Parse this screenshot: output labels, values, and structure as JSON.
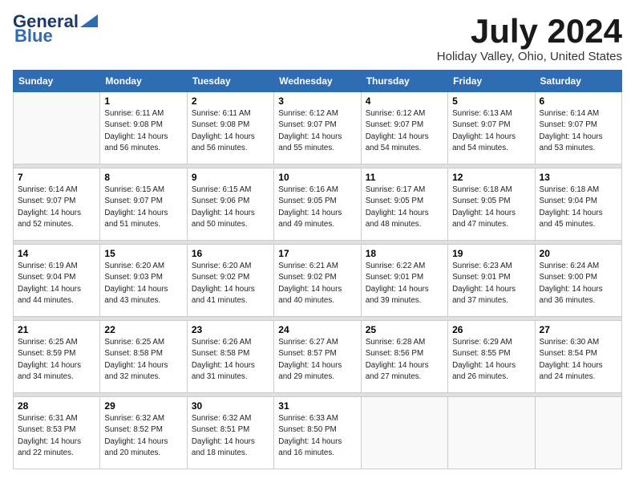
{
  "header": {
    "logo_general": "General",
    "logo_blue": "Blue",
    "month": "July 2024",
    "location": "Holiday Valley, Ohio, United States"
  },
  "days_of_week": [
    "Sunday",
    "Monday",
    "Tuesday",
    "Wednesday",
    "Thursday",
    "Friday",
    "Saturday"
  ],
  "weeks": [
    [
      {
        "day": "",
        "sunrise": "",
        "sunset": "",
        "daylight": ""
      },
      {
        "day": "1",
        "sunrise": "Sunrise: 6:11 AM",
        "sunset": "Sunset: 9:08 PM",
        "daylight": "Daylight: 14 hours and 56 minutes."
      },
      {
        "day": "2",
        "sunrise": "Sunrise: 6:11 AM",
        "sunset": "Sunset: 9:08 PM",
        "daylight": "Daylight: 14 hours and 56 minutes."
      },
      {
        "day": "3",
        "sunrise": "Sunrise: 6:12 AM",
        "sunset": "Sunset: 9:07 PM",
        "daylight": "Daylight: 14 hours and 55 minutes."
      },
      {
        "day": "4",
        "sunrise": "Sunrise: 6:12 AM",
        "sunset": "Sunset: 9:07 PM",
        "daylight": "Daylight: 14 hours and 54 minutes."
      },
      {
        "day": "5",
        "sunrise": "Sunrise: 6:13 AM",
        "sunset": "Sunset: 9:07 PM",
        "daylight": "Daylight: 14 hours and 54 minutes."
      },
      {
        "day": "6",
        "sunrise": "Sunrise: 6:14 AM",
        "sunset": "Sunset: 9:07 PM",
        "daylight": "Daylight: 14 hours and 53 minutes."
      }
    ],
    [
      {
        "day": "7",
        "sunrise": "Sunrise: 6:14 AM",
        "sunset": "Sunset: 9:07 PM",
        "daylight": "Daylight: 14 hours and 52 minutes."
      },
      {
        "day": "8",
        "sunrise": "Sunrise: 6:15 AM",
        "sunset": "Sunset: 9:07 PM",
        "daylight": "Daylight: 14 hours and 51 minutes."
      },
      {
        "day": "9",
        "sunrise": "Sunrise: 6:15 AM",
        "sunset": "Sunset: 9:06 PM",
        "daylight": "Daylight: 14 hours and 50 minutes."
      },
      {
        "day": "10",
        "sunrise": "Sunrise: 6:16 AM",
        "sunset": "Sunset: 9:05 PM",
        "daylight": "Daylight: 14 hours and 49 minutes."
      },
      {
        "day": "11",
        "sunrise": "Sunrise: 6:17 AM",
        "sunset": "Sunset: 9:05 PM",
        "daylight": "Daylight: 14 hours and 48 minutes."
      },
      {
        "day": "12",
        "sunrise": "Sunrise: 6:18 AM",
        "sunset": "Sunset: 9:05 PM",
        "daylight": "Daylight: 14 hours and 47 minutes."
      },
      {
        "day": "13",
        "sunrise": "Sunrise: 6:18 AM",
        "sunset": "Sunset: 9:04 PM",
        "daylight": "Daylight: 14 hours and 45 minutes."
      }
    ],
    [
      {
        "day": "14",
        "sunrise": "Sunrise: 6:19 AM",
        "sunset": "Sunset: 9:04 PM",
        "daylight": "Daylight: 14 hours and 44 minutes."
      },
      {
        "day": "15",
        "sunrise": "Sunrise: 6:20 AM",
        "sunset": "Sunset: 9:03 PM",
        "daylight": "Daylight: 14 hours and 43 minutes."
      },
      {
        "day": "16",
        "sunrise": "Sunrise: 6:20 AM",
        "sunset": "Sunset: 9:02 PM",
        "daylight": "Daylight: 14 hours and 41 minutes."
      },
      {
        "day": "17",
        "sunrise": "Sunrise: 6:21 AM",
        "sunset": "Sunset: 9:02 PM",
        "daylight": "Daylight: 14 hours and 40 minutes."
      },
      {
        "day": "18",
        "sunrise": "Sunrise: 6:22 AM",
        "sunset": "Sunset: 9:01 PM",
        "daylight": "Daylight: 14 hours and 39 minutes."
      },
      {
        "day": "19",
        "sunrise": "Sunrise: 6:23 AM",
        "sunset": "Sunset: 9:01 PM",
        "daylight": "Daylight: 14 hours and 37 minutes."
      },
      {
        "day": "20",
        "sunrise": "Sunrise: 6:24 AM",
        "sunset": "Sunset: 9:00 PM",
        "daylight": "Daylight: 14 hours and 36 minutes."
      }
    ],
    [
      {
        "day": "21",
        "sunrise": "Sunrise: 6:25 AM",
        "sunset": "Sunset: 8:59 PM",
        "daylight": "Daylight: 14 hours and 34 minutes."
      },
      {
        "day": "22",
        "sunrise": "Sunrise: 6:25 AM",
        "sunset": "Sunset: 8:58 PM",
        "daylight": "Daylight: 14 hours and 32 minutes."
      },
      {
        "day": "23",
        "sunrise": "Sunrise: 6:26 AM",
        "sunset": "Sunset: 8:58 PM",
        "daylight": "Daylight: 14 hours and 31 minutes."
      },
      {
        "day": "24",
        "sunrise": "Sunrise: 6:27 AM",
        "sunset": "Sunset: 8:57 PM",
        "daylight": "Daylight: 14 hours and 29 minutes."
      },
      {
        "day": "25",
        "sunrise": "Sunrise: 6:28 AM",
        "sunset": "Sunset: 8:56 PM",
        "daylight": "Daylight: 14 hours and 27 minutes."
      },
      {
        "day": "26",
        "sunrise": "Sunrise: 6:29 AM",
        "sunset": "Sunset: 8:55 PM",
        "daylight": "Daylight: 14 hours and 26 minutes."
      },
      {
        "day": "27",
        "sunrise": "Sunrise: 6:30 AM",
        "sunset": "Sunset: 8:54 PM",
        "daylight": "Daylight: 14 hours and 24 minutes."
      }
    ],
    [
      {
        "day": "28",
        "sunrise": "Sunrise: 6:31 AM",
        "sunset": "Sunset: 8:53 PM",
        "daylight": "Daylight: 14 hours and 22 minutes."
      },
      {
        "day": "29",
        "sunrise": "Sunrise: 6:32 AM",
        "sunset": "Sunset: 8:52 PM",
        "daylight": "Daylight: 14 hours and 20 minutes."
      },
      {
        "day": "30",
        "sunrise": "Sunrise: 6:32 AM",
        "sunset": "Sunset: 8:51 PM",
        "daylight": "Daylight: 14 hours and 18 minutes."
      },
      {
        "day": "31",
        "sunrise": "Sunrise: 6:33 AM",
        "sunset": "Sunset: 8:50 PM",
        "daylight": "Daylight: 14 hours and 16 minutes."
      },
      {
        "day": "",
        "sunrise": "",
        "sunset": "",
        "daylight": ""
      },
      {
        "day": "",
        "sunrise": "",
        "sunset": "",
        "daylight": ""
      },
      {
        "day": "",
        "sunrise": "",
        "sunset": "",
        "daylight": ""
      }
    ]
  ]
}
